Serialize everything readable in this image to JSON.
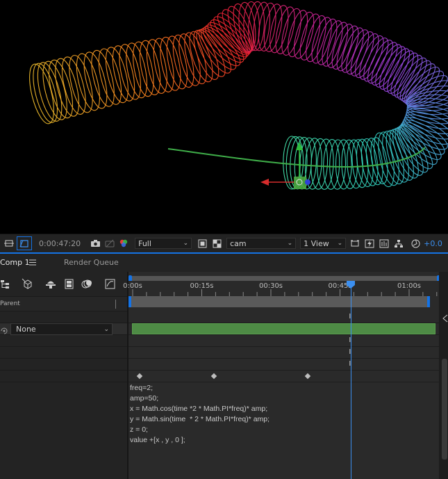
{
  "viewer": {
    "timecode": "0:00:47:20",
    "resolution": "Full",
    "camera": "cam",
    "view_layout": "1 View",
    "exposure": "+0.0",
    "colors": {
      "accent": "#1473e6",
      "path": "#3fae49",
      "gizmo_x": "#d62c2c",
      "gizmo_y": "#2fbf3a",
      "gizmo_z": "#2f3fd8"
    }
  },
  "panels": {
    "active_tab": "Comp 1",
    "menu_icon": "hamburger-icon",
    "other_tab": "Render Queue"
  },
  "timeline": {
    "ruler_labels": [
      "0:00s",
      "00:15s",
      "00:30s",
      "00:45s",
      "01:00s"
    ],
    "current_time_fraction": 0.79,
    "parent_header": "Parent",
    "parent_value": "None",
    "expression_lines": [
      "freq=2;",
      "amp=50;",
      "x = Math.cos(time *2 * Math.PI*freq)* amp;",
      "y = Math.sin(time  * 2 * Math.PI*freq)* amp;",
      "z = 0;",
      "value +[x , y , 0 ];"
    ]
  }
}
